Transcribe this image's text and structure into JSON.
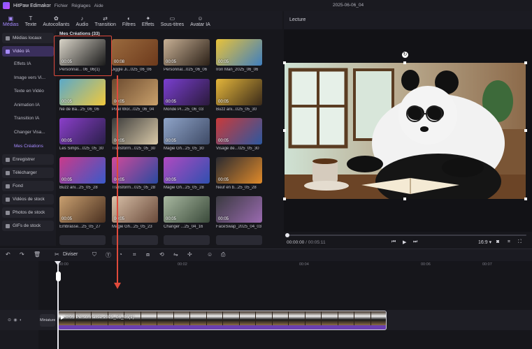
{
  "app": {
    "name": "HitPaw Edimakor",
    "window_title": "2025-06-06_04"
  },
  "menubar": [
    "Fichier",
    "Réglages",
    "Aide"
  ],
  "toolbar": {
    "tabs": [
      {
        "label": "Médias",
        "icon": "media-icon"
      },
      {
        "label": "Texte",
        "icon": "text-icon"
      },
      {
        "label": "Autocollants",
        "icon": "sticker-icon"
      },
      {
        "label": "Audio",
        "icon": "music-icon"
      },
      {
        "label": "Transition",
        "icon": "transition-icon"
      },
      {
        "label": "Filtres",
        "icon": "filter-icon"
      },
      {
        "label": "Effets",
        "icon": "effects-icon"
      },
      {
        "label": "Sous-titres",
        "icon": "subtitles-icon"
      },
      {
        "label": "Avatar IA",
        "icon": "avatar-icon"
      }
    ],
    "active": "Médias"
  },
  "sidebar": {
    "items": [
      {
        "label": "Médias locaux",
        "type": "main"
      },
      {
        "label": "Vidéo IA",
        "type": "selected"
      },
      {
        "label": "Effets IA",
        "type": "sub"
      },
      {
        "label": "Image vers Vi...",
        "type": "sub"
      },
      {
        "label": "Texte en Vidéo",
        "type": "sub"
      },
      {
        "label": "Animation IA",
        "type": "sub"
      },
      {
        "label": "Transition IA",
        "type": "sub"
      },
      {
        "label": "Changer Visa...",
        "type": "sub"
      },
      {
        "label": "Mes Créations",
        "type": "active-sub"
      },
      {
        "label": "Enregistrer",
        "type": "main"
      },
      {
        "label": "Télécharger",
        "type": "main"
      },
      {
        "label": "Fond",
        "type": "main"
      },
      {
        "label": "Vidéos de stock",
        "type": "main"
      },
      {
        "label": "Photos de stock",
        "type": "main"
      },
      {
        "label": "GIFs de stock",
        "type": "main"
      }
    ]
  },
  "media": {
    "heading": "Mes Créations (33)",
    "tiles": [
      {
        "label": "Personnal... 06_06(1)",
        "duration": "00:05",
        "colors": [
          "#d9d4c8",
          "#1b1b1b"
        ]
      },
      {
        "label": "Jiggle Ji...025_06_06",
        "duration": "00:08",
        "colors": [
          "#9a6a3e",
          "#6d3a1c"
        ]
      },
      {
        "label": "Personnal...025_06_06",
        "duration": "00:05",
        "colors": [
          "#c7b095",
          "#2b2017"
        ]
      },
      {
        "label": "Iron Man_2025_06_06",
        "duration": "00:05",
        "colors": [
          "#e8c23a",
          "#3f7fbf"
        ]
      },
      {
        "label": "Né de Ba...25_06_06",
        "duration": "00:05",
        "colors": [
          "#5aa9c9",
          "#f0c83c"
        ]
      },
      {
        "label": "Pixel Wor...025_06_04",
        "duration": "00:05",
        "colors": [
          "#6b4a2f",
          "#c9a06b"
        ]
      },
      {
        "label": "Monde Pi...25_06_03",
        "duration": "00:05",
        "colors": [
          "#7a3fd0",
          "#2b1a3c"
        ]
      },
      {
        "label": "Buzz ani...025_05_30",
        "duration": "00:05",
        "colors": [
          "#e3b53a",
          "#3a2a1a"
        ]
      },
      {
        "label": "Les Simps...025_05_30",
        "duration": "00:05",
        "colors": [
          "#8a3fc9",
          "#2a1f4a"
        ]
      },
      {
        "label": "Transform...025_05_30",
        "duration": "00:05",
        "colors": [
          "#3a3a3a",
          "#d9c9a8"
        ]
      },
      {
        "label": "Magie Gh...25_05_30",
        "duration": "00:05",
        "colors": [
          "#8fa4c8",
          "#3e4a66"
        ]
      },
      {
        "label": "Visage de...025_05_30",
        "duration": "00:05",
        "colors": [
          "#c93a3a",
          "#2c58a0"
        ]
      },
      {
        "label": "Buzz ani...25_05_28",
        "duration": "00:05",
        "colors": [
          "#c93a8a",
          "#3a5ac9"
        ]
      },
      {
        "label": "Transform...025_05_28",
        "duration": "00:05",
        "colors": [
          "#d04a9a",
          "#2a4aa0"
        ]
      },
      {
        "label": "Magie Gh...25_05_28",
        "duration": "00:05",
        "colors": [
          "#b04ac0",
          "#3050b0"
        ]
      },
      {
        "label": "Neuf en b...25_05_28",
        "duration": "00:05",
        "colors": [
          "#2a2a30",
          "#e08a2a"
        ]
      },
      {
        "label": "Embrasse...25_05_27",
        "duration": "00:05",
        "colors": [
          "#c9a070",
          "#4a3020"
        ]
      },
      {
        "label": "Magie Gh...25_05_23",
        "duration": "00:05",
        "colors": [
          "#d8c0a8",
          "#6a4a3a"
        ]
      },
      {
        "label": "Changer ...25_04_16",
        "duration": "00:05",
        "colors": [
          "#a8b8a0",
          "#3a4a3a"
        ]
      },
      {
        "label": "FaceSwap_2025_04_03",
        "duration": "00:05",
        "colors": [
          "#3a3a40",
          "#9a6ab0"
        ]
      }
    ]
  },
  "preview": {
    "title": "Lecture",
    "time_current": "00:00:00",
    "time_total": "/ 00:05:11",
    "aspect": "16:9"
  },
  "timeline": {
    "split_label": "Diviser",
    "ruler": [
      "00:00",
      "00:02",
      "00:04",
      "00:06",
      "00:07"
    ],
    "clip_label": "0:05 Personnalisé 2025_06_06(1)",
    "track_button": "Miniature"
  }
}
